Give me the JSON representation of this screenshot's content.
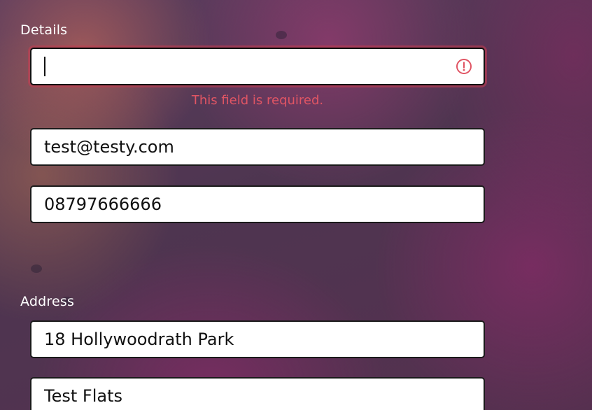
{
  "details": {
    "label": "Details",
    "name_field": {
      "value": "",
      "error": "This field is required."
    },
    "email_field": {
      "value": "test@testy.com"
    },
    "phone_field": {
      "value": "08797666666"
    }
  },
  "address": {
    "label": "Address",
    "line1_field": {
      "value": "18 Hollywoodrath Park"
    },
    "line2_field": {
      "value": "Test Flats"
    }
  },
  "icons": {
    "error": "error-circle-icon"
  },
  "colors": {
    "error": "#e05564",
    "field_border": "#1a1a1a",
    "label": "#ffffff"
  }
}
